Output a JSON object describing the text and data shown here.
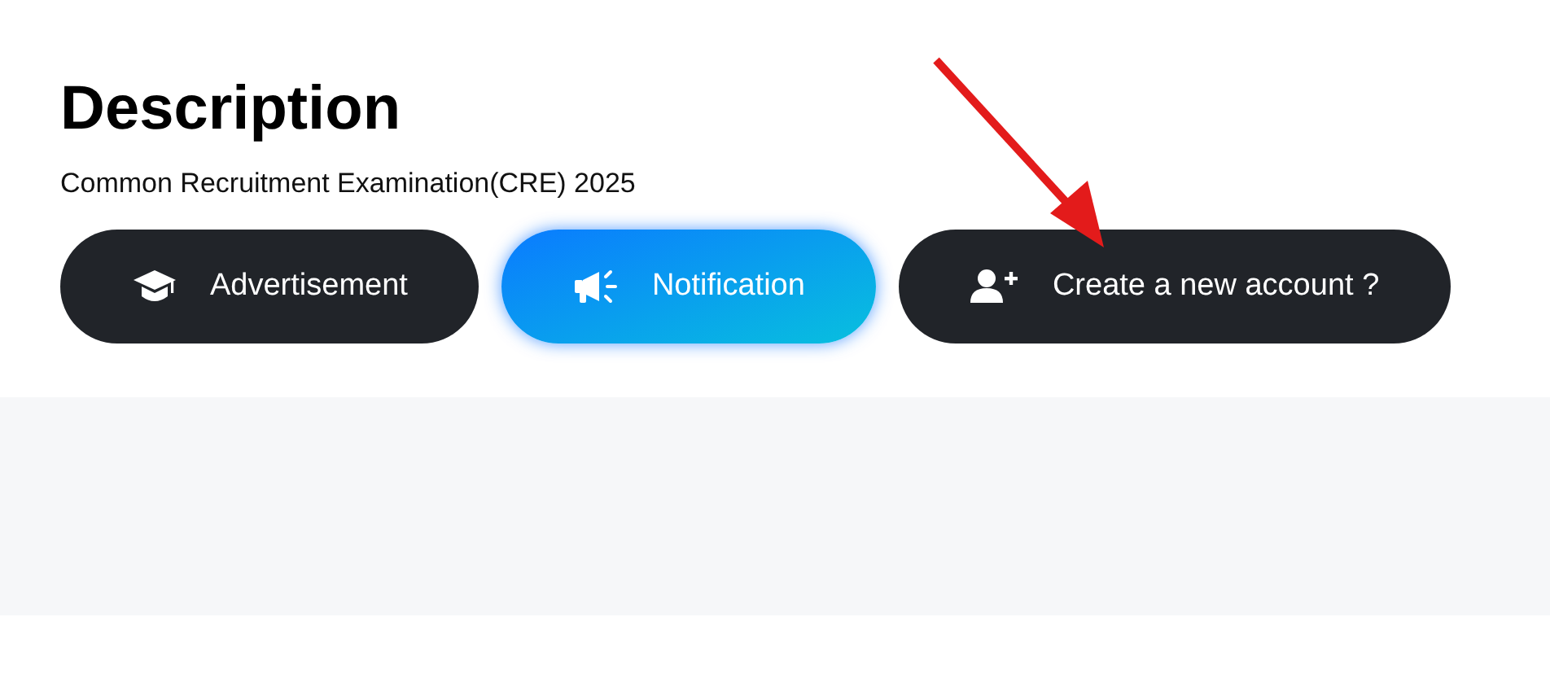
{
  "title": "Description",
  "subtitle": "Common Recruitment Examination(CRE) 2025",
  "buttons": [
    {
      "label": "Advertisement",
      "kind": "dark"
    },
    {
      "label": "Notification",
      "kind": "primary"
    },
    {
      "label": "Create a new account ?",
      "kind": "dark"
    }
  ]
}
